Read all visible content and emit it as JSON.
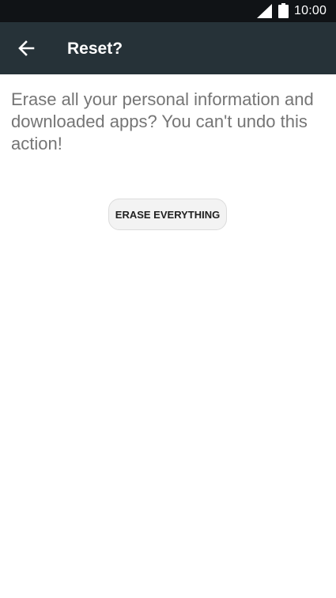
{
  "status_bar": {
    "time": "10:00",
    "icons": [
      "signal-icon",
      "battery-icon"
    ]
  },
  "app_bar": {
    "title": "Reset?",
    "back_icon": "back-arrow-icon"
  },
  "content": {
    "message": "Erase all your personal information and downloaded apps? You can't undo this action!",
    "erase_button_label": "ERASE EVERYTHING"
  },
  "colors": {
    "status_bar": "#101316",
    "app_bar": "#263238",
    "message_text": "#757575",
    "button_background": "#f3f3f3"
  }
}
